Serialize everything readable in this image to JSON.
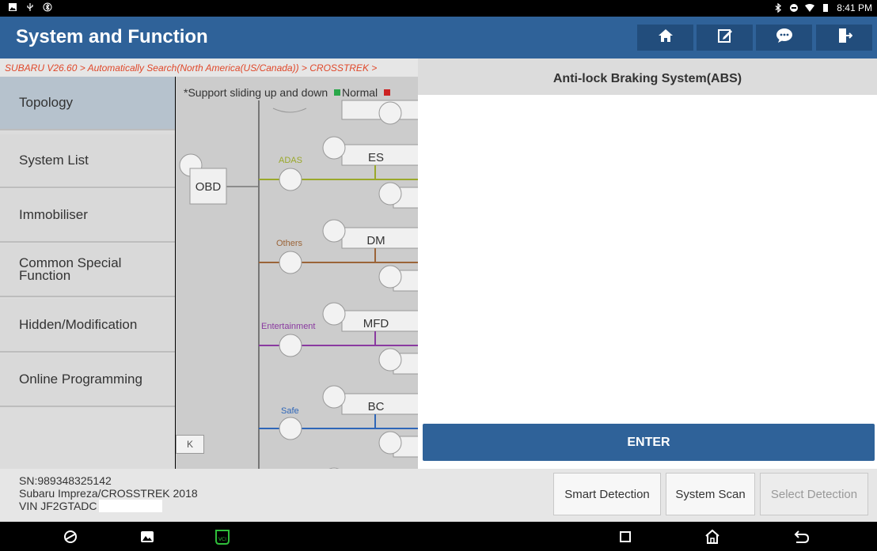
{
  "statusbar": {
    "time": "8:41 PM"
  },
  "header": {
    "title": "System and Function"
  },
  "toolbar_icons": [
    "home-icon",
    "edit-icon",
    "chat-icon",
    "exit-icon"
  ],
  "breadcrumb": "SUBARU V26.60 > Automatically Search(North America(US/Canada)) > CROSSTREK >",
  "nav": {
    "items": [
      {
        "label": "Topology"
      },
      {
        "label": "System List"
      },
      {
        "label": "Immobiliser"
      },
      {
        "label": "Common Special Function"
      },
      {
        "label": "Hidden/Modification"
      },
      {
        "label": "Online Programming"
      }
    ]
  },
  "topology": {
    "note": "*Support sliding up and down",
    "legend_normal": "Normal",
    "root": "OBD",
    "collapse_label": "K",
    "buses": [
      {
        "name": "ADAS",
        "module": "ES",
        "color": "#9aa82a"
      },
      {
        "name": "Others",
        "module": "DM",
        "color": "#9b6438"
      },
      {
        "name": "Entertainment",
        "module": "MFD",
        "color": "#8a3aa0"
      },
      {
        "name": "Safe",
        "module": "BC",
        "color": "#2e66b8"
      }
    ],
    "colors": {
      "normal": "#2aa84a",
      "fault": "#cc2222"
    }
  },
  "panel": {
    "title": "Anti-lock Braking System(ABS)",
    "enter_label": "ENTER"
  },
  "footer": {
    "sn": "SN:989348325142",
    "vehicle": "Subaru Impreza/CROSSTREK 2018",
    "vin": "VIN JF2GTADC",
    "buttons": {
      "smart": "Smart Detection",
      "scan": "System Scan",
      "select": "Select Detection"
    }
  },
  "navbar_icons": [
    "browser-icon",
    "gallery-icon",
    "vci-icon",
    "recent-apps-icon",
    "home-icon",
    "back-icon"
  ]
}
